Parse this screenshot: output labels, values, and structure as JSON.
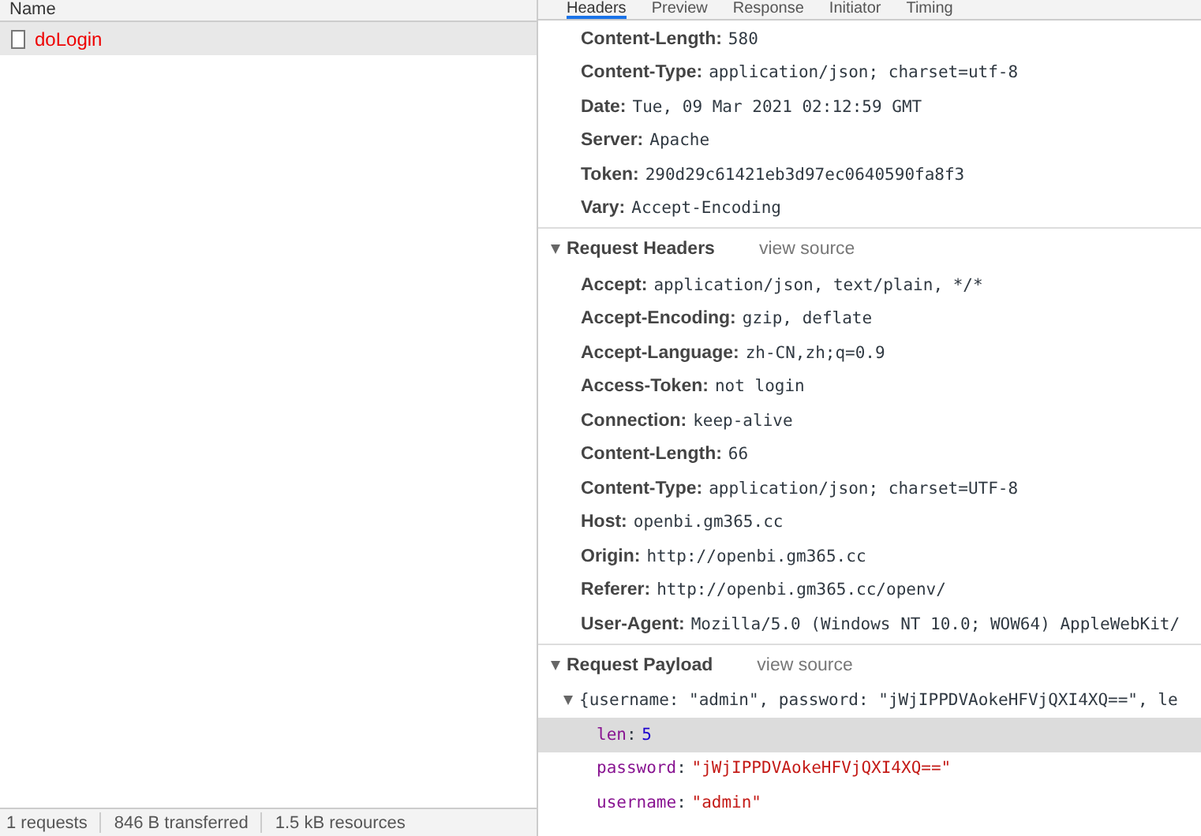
{
  "request_list": {
    "column_header": "Name",
    "requests": [
      {
        "name": "doLogin",
        "selected": true,
        "failed": true
      }
    ]
  },
  "status_bar": [
    "1 requests",
    "846 B transferred",
    "1.5 kB resources"
  ],
  "tabs": [
    {
      "label": "Headers",
      "selected": true
    },
    {
      "label": "Preview",
      "selected": false
    },
    {
      "label": "Response",
      "selected": false
    },
    {
      "label": "Initiator",
      "selected": false
    },
    {
      "label": "Timing",
      "selected": false
    }
  ],
  "response_headers": [
    {
      "name": "Content-Length:",
      "value": "580"
    },
    {
      "name": "Content-Type:",
      "value": "application/json; charset=utf-8"
    },
    {
      "name": "Date:",
      "value": "Tue, 09 Mar 2021 02:12:59 GMT"
    },
    {
      "name": "Server:",
      "value": "Apache"
    },
    {
      "name": "Token:",
      "value": "290d29c61421eb3d97ec0640590fa8f3"
    },
    {
      "name": "Vary:",
      "value": "Accept-Encoding"
    }
  ],
  "request_headers": {
    "title": "Request Headers",
    "expanded": true,
    "link": "view source",
    "headers": [
      {
        "name": "Accept:",
        "value": "application/json, text/plain, */*"
      },
      {
        "name": "Accept-Encoding:",
        "value": "gzip, deflate"
      },
      {
        "name": "Accept-Language:",
        "value": "zh-CN,zh;q=0.9"
      },
      {
        "name": "Access-Token:",
        "value": "not login"
      },
      {
        "name": "Connection:",
        "value": "keep-alive"
      },
      {
        "name": "Content-Length:",
        "value": "66"
      },
      {
        "name": "Content-Type:",
        "value": "application/json; charset=UTF-8"
      },
      {
        "name": "Host:",
        "value": "openbi.gm365.cc"
      },
      {
        "name": "Origin:",
        "value": "http://openbi.gm365.cc"
      },
      {
        "name": "Referer:",
        "value": "http://openbi.gm365.cc/openv/"
      },
      {
        "name": "User-Agent:",
        "value": "Mozilla/5.0 (Windows NT 10.0; WOW64) AppleWebKit/"
      }
    ]
  },
  "request_payload": {
    "title": "Request Payload",
    "expanded": true,
    "link": "view source",
    "object": {
      "summary": "{username: \"admin\", password: \"jWjIPPDVAokeHFVjQXI4XQ==\", le",
      "expanded": true,
      "children": [
        {
          "key": "len",
          "separator": ":",
          "value": "5",
          "kind": "number",
          "selected": true
        },
        {
          "key": "password",
          "separator": ":",
          "value": "\"jWjIPPDVAokeHFVjQXI4XQ==\"",
          "kind": "string",
          "selected": false
        },
        {
          "key": "username",
          "separator": ":",
          "value": "\"admin\"",
          "kind": "string",
          "selected": false
        }
      ]
    }
  }
}
